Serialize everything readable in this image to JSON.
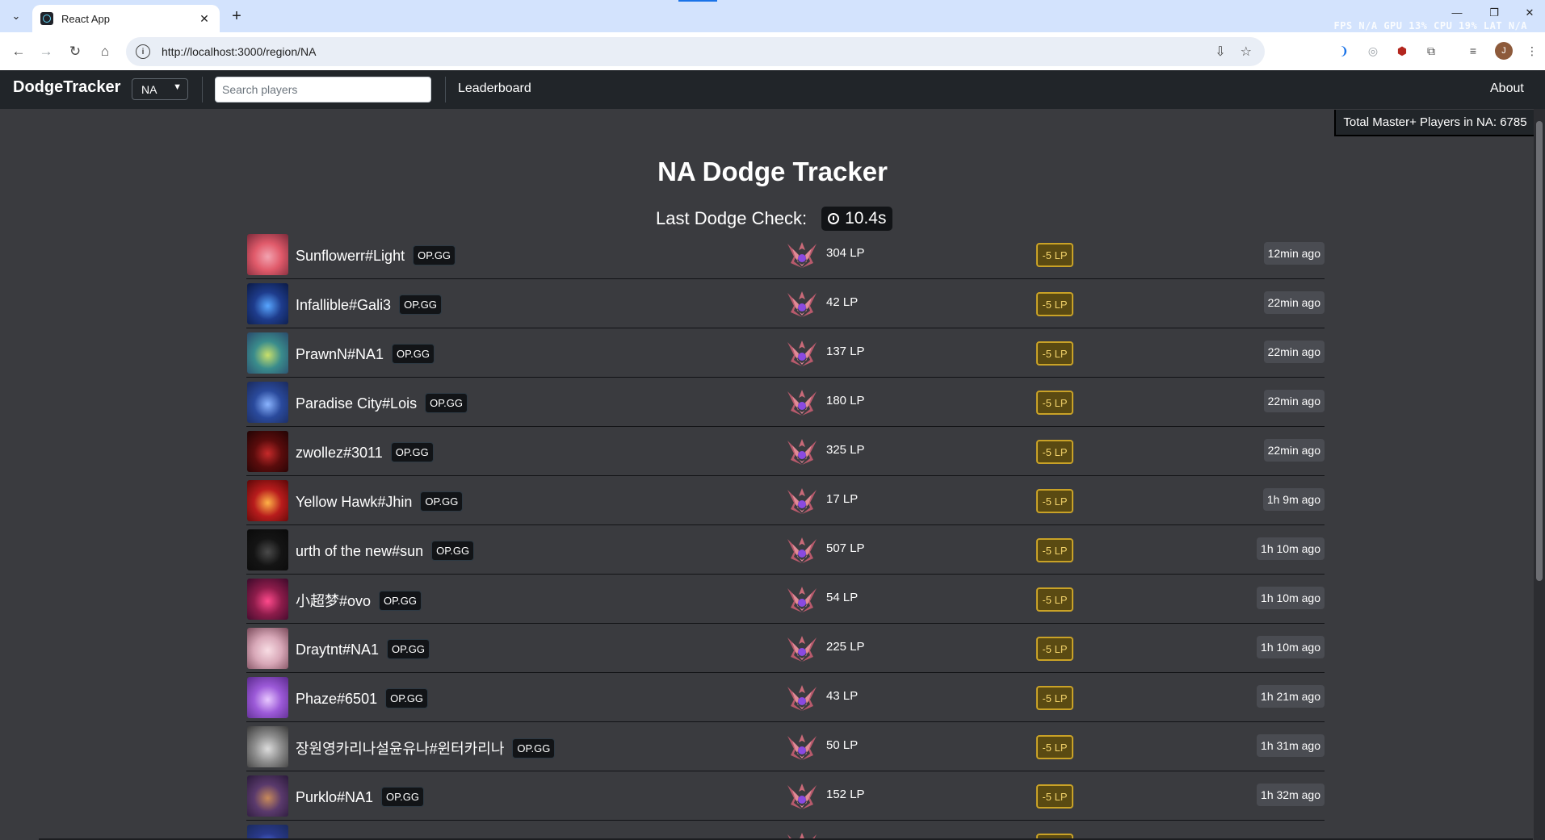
{
  "browser": {
    "tab_title": "React App",
    "new_tab": "+",
    "url": "http://localhost:3000/region/NA",
    "perf_overlay": "FPS N/A GPU 13% CPU 19% LAT N/A",
    "profile_initial": "J"
  },
  "navbar": {
    "brand": "DodgeTracker",
    "region": "NA",
    "search_placeholder": "Search players",
    "leaderboard": "Leaderboard",
    "about": "About"
  },
  "total_players": "Total Master+ Players in NA: 6785",
  "main": {
    "title": "NA Dodge Tracker",
    "last_check_label": "Last Dodge Check:",
    "last_check_value": "10.4s"
  },
  "opgg_label": "OP.GG",
  "dodges": [
    {
      "name": "Sunflowerr#Light",
      "lp": "304 LP",
      "loss": "-5 LP",
      "ago": "12min ago",
      "avatar": [
        "#e05a6a",
        "#f2a3b0",
        "#7a2a3a"
      ]
    },
    {
      "name": "Infallible#Gali3",
      "lp": "42 LP",
      "loss": "-5 LP",
      "ago": "22min ago",
      "avatar": [
        "#1e3c8c",
        "#58a6ff",
        "#0b1a44"
      ]
    },
    {
      "name": "PrawnN#NA1",
      "lp": "137 LP",
      "loss": "-5 LP",
      "ago": "22min ago",
      "avatar": [
        "#3a8c8c",
        "#c9e06a",
        "#2a4a6c"
      ]
    },
    {
      "name": "Paradise City#Lois",
      "lp": "180 LP",
      "loss": "-5 LP",
      "ago": "22min ago",
      "avatar": [
        "#2a4a9c",
        "#8ab4ff",
        "#1a2a5c"
      ]
    },
    {
      "name": "zwollez#3011",
      "lp": "325 LP",
      "loss": "-5 LP",
      "ago": "22min ago",
      "avatar": [
        "#5a0c0c",
        "#c62a2a",
        "#200404"
      ]
    },
    {
      "name": "Yellow Hawk#Jhin",
      "lp": "17 LP",
      "loss": "-5 LP",
      "ago": "1h 9m ago",
      "avatar": [
        "#b81c1c",
        "#ffb347",
        "#5a0808"
      ]
    },
    {
      "name": "urth of the new#sun",
      "lp": "507 LP",
      "loss": "-5 LP",
      "ago": "1h 10m ago",
      "avatar": [
        "#141414",
        "#4a4a4a",
        "#0a0a0a"
      ]
    },
    {
      "name": "小超梦#ovo",
      "lp": "54 LP",
      "loss": "-5 LP",
      "ago": "1h 10m ago",
      "avatar": [
        "#8c1c4a",
        "#ff4a8c",
        "#3a0a2a"
      ]
    },
    {
      "name": "Draytnt#NA1",
      "lp": "225 LP",
      "loss": "-5 LP",
      "ago": "1h 10m ago",
      "avatar": [
        "#d8a8b8",
        "#f8dde4",
        "#7a4a5a"
      ]
    },
    {
      "name": "Phaze#6501",
      "lp": "43 LP",
      "loss": "-5 LP",
      "ago": "1h 21m ago",
      "avatar": [
        "#9c5ad8",
        "#e8c8ff",
        "#5a2a8c"
      ]
    },
    {
      "name": "장원영카리나설윤유나#윈터카리나",
      "lp": "50 LP",
      "loss": "-5 LP",
      "ago": "1h 31m ago",
      "avatar": [
        "#8c8c8c",
        "#dcdcdc",
        "#3a3a3a"
      ]
    },
    {
      "name": "Purklo#NA1",
      "lp": "152 LP",
      "loss": "-5 LP",
      "ago": "1h 32m ago",
      "avatar": [
        "#5a3a6c",
        "#c88a5a",
        "#2a1a3a"
      ]
    },
    {
      "name": "",
      "lp": "",
      "loss": "",
      "ago": "",
      "avatar": [
        "#2a3a8c",
        "#5a7aff",
        "#1a2a5c"
      ]
    }
  ],
  "colors": {
    "page_bg": "#3a3b3f",
    "navbar_bg": "#212529",
    "lp_loss_border": "#c9a227",
    "emblem_primary": "#c86a78",
    "emblem_gem": "#8a4ae0"
  }
}
